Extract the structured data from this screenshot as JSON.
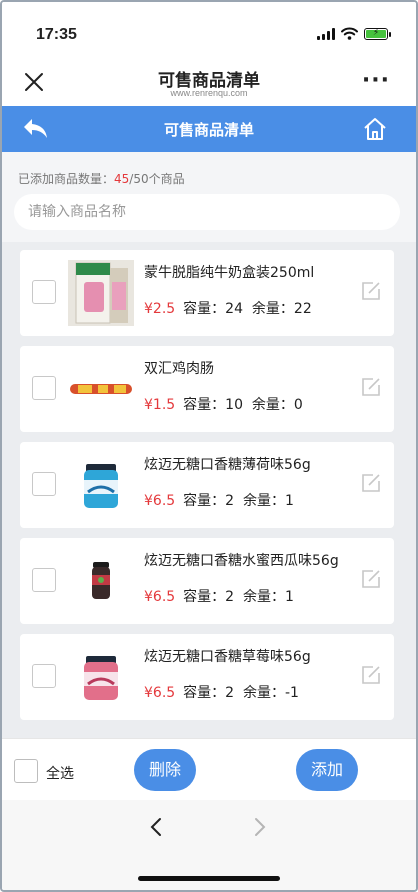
{
  "status": {
    "time": "17:35"
  },
  "header": {
    "title": "可售商品清单",
    "subtitle": "www.renrenqu.com",
    "more": "···"
  },
  "nav": {
    "title": "可售商品清单"
  },
  "summary": {
    "prefix": "已添加商品数量：",
    "count": "45",
    "suffix": "/50个商品"
  },
  "search": {
    "placeholder": "请输入商品名称"
  },
  "items": [
    {
      "name": "蒙牛脱脂纯牛奶盒装250ml",
      "price": "¥2.5",
      "capacity": "容量：24",
      "stock": "余量：22",
      "icon": "milk-carton"
    },
    {
      "name": "双汇鸡肉肠",
      "price": "¥1.5",
      "capacity": "容量：10",
      "stock": "余量：0",
      "icon": "sausage"
    },
    {
      "name": "炫迈无糖口香糖薄荷味56g",
      "price": "¥6.5",
      "capacity": "容量：2",
      "stock": "余量：1",
      "icon": "gum-jar-mint"
    },
    {
      "name": "炫迈无糖口香糖水蜜西瓜味56g",
      "price": "¥6.5",
      "capacity": "容量：2",
      "stock": "余量：1",
      "icon": "gum-jar-watermelon"
    },
    {
      "name": "炫迈无糖口香糖草莓味56g",
      "price": "¥6.5",
      "capacity": "容量：2",
      "stock": "余量：-1",
      "icon": "gum-jar-strawberry"
    }
  ],
  "footer": {
    "select_all": "全选",
    "delete": "删除",
    "add": "添加"
  },
  "colors": {
    "accent": "#4a8ee6",
    "price": "#e4393c"
  }
}
